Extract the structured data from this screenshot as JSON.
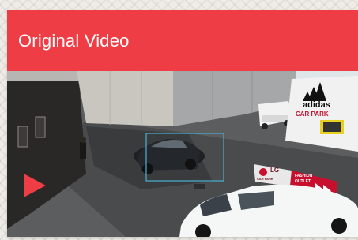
{
  "header": {
    "title": "Original Video"
  },
  "video": {
    "signs": {
      "brand": "adidas",
      "car_park": "CAR PARK",
      "lg": "LG",
      "lg_sub": "CAR PARK",
      "fashion_1": "FASHION",
      "fashion_2": "OUTLET"
    },
    "colors": {
      "accent": "#ef3d45",
      "detection_box": "#4aa8c8"
    }
  }
}
